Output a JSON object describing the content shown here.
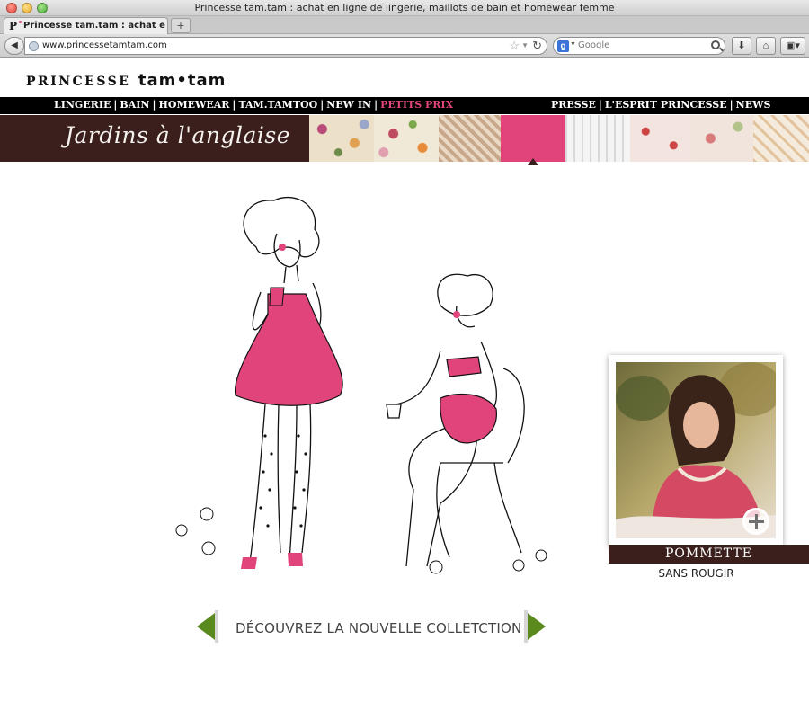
{
  "window": {
    "title": "Princesse tam.tam : achat en ligne de lingerie, maillots de bain et homewear femme",
    "tab_title": "Princesse tam.tam : achat en lig...",
    "url": "www.princessetamtam.com",
    "search_placeholder": "Google"
  },
  "logo": {
    "part1": "PRINCESSE",
    "part2": "tam•tam"
  },
  "nav": {
    "left": [
      {
        "label": "LINGERIE"
      },
      {
        "label": "BAIN"
      },
      {
        "label": "HOMEWEAR"
      },
      {
        "label": "TAM.TAMTOO"
      },
      {
        "label": "NEW IN"
      },
      {
        "label": "PETITS PRIX"
      }
    ],
    "right": [
      {
        "label": "PRESSE"
      },
      {
        "label": "L'ESPRIT PRINCESSE"
      },
      {
        "label": "NEWS"
      }
    ],
    "separator": "|",
    "highlight_color": "#e0447b"
  },
  "banner": {
    "title": "Jardins à l'anglaise"
  },
  "product": {
    "name": "POMMETTE",
    "subtitle": "SANS ROUGIR"
  },
  "cta": {
    "label": "DÉCOUVREZ LA NOUVELLE COLLETCTION"
  },
  "colors": {
    "brand_brown": "#3a1f1d",
    "brand_pink": "#e0447b",
    "arrow_green": "#5a8a1e"
  }
}
